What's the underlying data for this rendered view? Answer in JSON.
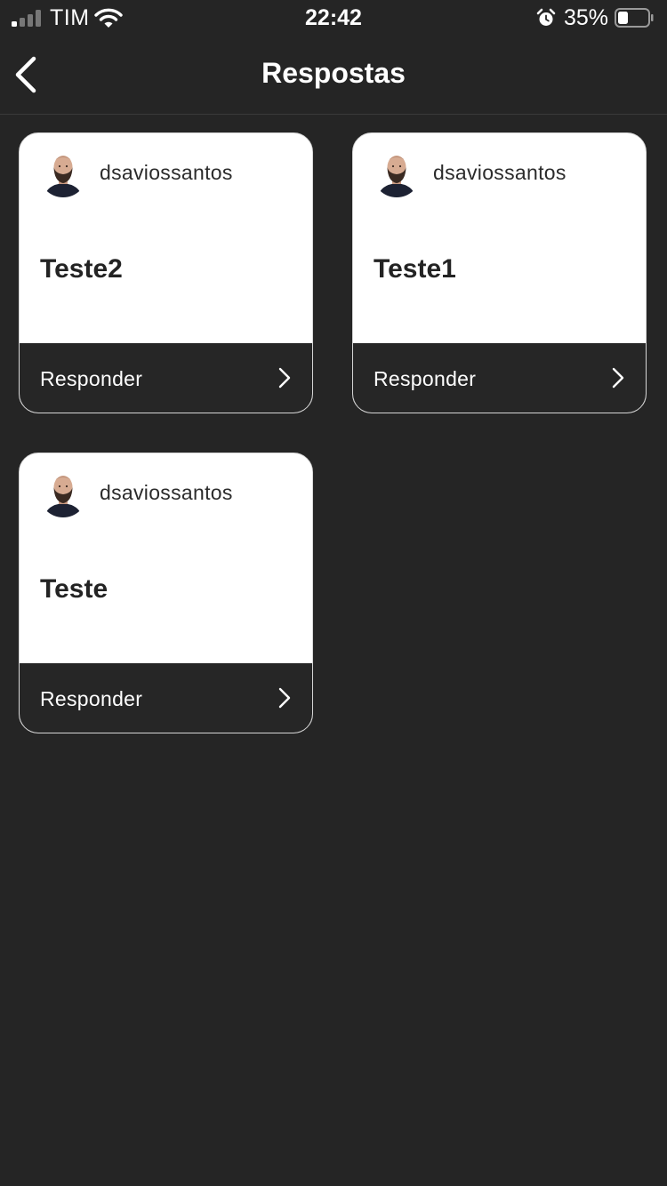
{
  "status_bar": {
    "carrier": "TIM",
    "time": "22:42",
    "battery_percent": "35%",
    "battery_level": 0.35,
    "signal_bars_active": 1,
    "icons": [
      "signal-icon",
      "wifi-icon",
      "alarm-icon",
      "battery-icon"
    ]
  },
  "nav": {
    "title": "Respostas",
    "back_icon": "chevron-left-icon"
  },
  "cards": [
    {
      "username": "dsaviossantos",
      "title": "Teste2",
      "action_label": "Responder"
    },
    {
      "username": "dsaviossantos",
      "title": "Teste1",
      "action_label": "Responder"
    },
    {
      "username": "dsaviossantos",
      "title": "Teste",
      "action_label": "Responder"
    }
  ],
  "colors": {
    "background": "#252525",
    "card_background": "#ffffff",
    "card_footer": "#262626",
    "text_primary": "#ffffff",
    "text_dark": "#232323"
  }
}
